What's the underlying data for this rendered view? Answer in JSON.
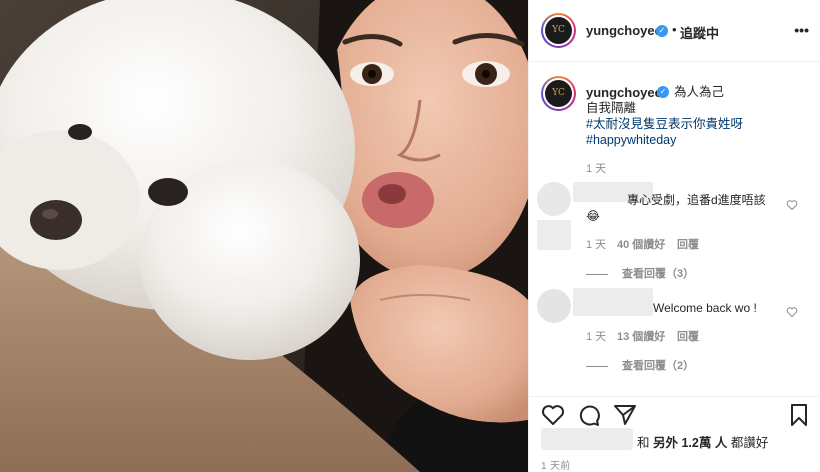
{
  "post": {
    "username": "yungchoyee",
    "follow_state": "追蹤中",
    "separator": "•",
    "more_icon": "more-horizontal-icon",
    "avatar_logo": "YC"
  },
  "caption": {
    "username": "yungchoyee",
    "line1": "為人為己",
    "line2": "自我隔離",
    "hashtag1": "#太耐沒見隻豆表示你貴姓呀",
    "hashtag2": "#happywhiteday",
    "time": "1 天"
  },
  "comments": [
    {
      "text_line1": "專心受劇，追番d進度唔該",
      "text_line2": "😂",
      "time": "1 天",
      "likes": "40 個讚好",
      "reply": "回覆",
      "view_replies": "查看回覆（3）"
    },
    {
      "text_line1": "Welcome back wo !",
      "time": "1 天",
      "likes": "13 個讚好",
      "reply": "回覆",
      "view_replies": "查看回覆（2）"
    }
  ],
  "footer": {
    "likes_prefix": "和",
    "likes_bold": "另外 1.2萬 人",
    "likes_suffix": "都讚好",
    "post_time": "1 天前"
  },
  "colors": {
    "link": "#00376b",
    "verified": "#3897f0",
    "muted": "#8e8e8e",
    "text": "#262626"
  }
}
